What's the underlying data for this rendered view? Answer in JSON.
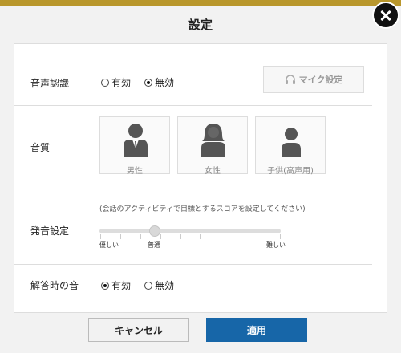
{
  "dialog": {
    "title": "設定"
  },
  "voice_recognition": {
    "label": "音声認識",
    "options": [
      "有効",
      "無効"
    ],
    "selected": "無効",
    "mic_button": "マイク設定"
  },
  "sound_quality": {
    "label": "音質",
    "voices": [
      "男性",
      "女性",
      "子供(高声用)"
    ]
  },
  "pronunciation": {
    "label": "発音設定",
    "hint": "(会話のアクティビティで目標とするスコアを設定してください)",
    "slider_labels": [
      "優しい",
      "普通",
      "難しい"
    ],
    "slider_value": "普通"
  },
  "answer_sound": {
    "label": "解答時の音",
    "options": [
      "有効",
      "無効"
    ],
    "selected": "有効"
  },
  "footer": {
    "cancel": "キャンセル",
    "apply": "適用"
  },
  "icons": {
    "close": "close-icon",
    "mic": "headphones-icon",
    "male": "male-user-icon",
    "female": "female-user-icon",
    "child": "child-user-icon"
  }
}
